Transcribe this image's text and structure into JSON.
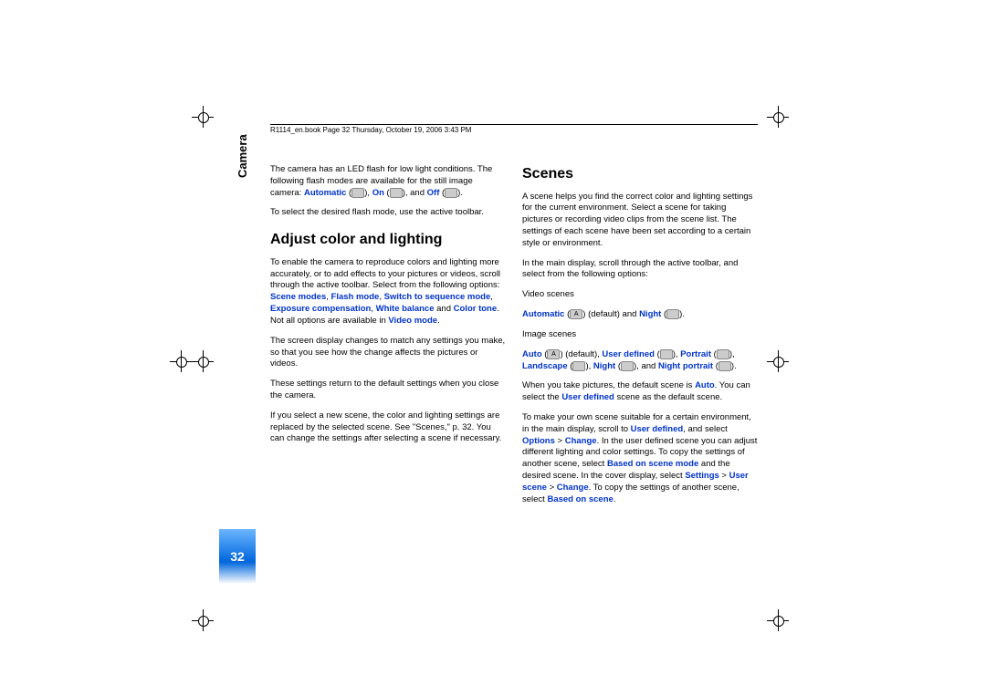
{
  "header": "R1114_en.book  Page 32  Thursday, October 19, 2006  3:43 PM",
  "side_label": "Camera",
  "page_number": "32",
  "col1": {
    "p1_a": "The camera has an LED flash for low light conditions. The following flash modes are available for the still image camera: ",
    "p1_auto": "Automatic",
    "p1_b": " (",
    "p1_c": "), ",
    "p1_on": "On",
    "p1_d": " (",
    "p1_e": "), and ",
    "p1_off": "Off",
    "p1_f": " (",
    "p1_g": ").",
    "p2": "To select the desired flash mode, use the active toolbar.",
    "h1": "Adjust color and lighting",
    "p3_a": "To enable the camera to reproduce colors and lighting more accurately, or to add effects to your pictures or videos, scroll through the active toolbar. Select from the following options: ",
    "p3_scene": "Scene modes",
    "p3_c1": ", ",
    "p3_flash": "Flash mode",
    "p3_c2": ", ",
    "p3_switch": "Switch to sequence mode",
    "p3_c3": ", ",
    "p3_exp": "Exposure compensation",
    "p3_c4": ", ",
    "p3_wb": "White balance",
    "p3_and": " and ",
    "p3_ct": "Color tone",
    "p3_b": ". Not all options are available in ",
    "p3_vm": "Video mode",
    "p3_d": ".",
    "p4": "The screen display changes to match any settings you make, so that you see how the change affects the pictures or videos.",
    "p5": "These settings return to the default settings when you close the camera.",
    "p6": "If you select a new scene, the color and lighting settings are replaced by the selected scene. See \"Scenes,\" p. 32. You can change the settings after selecting a scene if necessary."
  },
  "col2": {
    "h1": "Scenes",
    "p1": "A scene helps you find the correct color and lighting settings for the current environment. Select a scene for taking pictures or recording video clips from the scene list. The settings of each scene have been set according to a certain style or environment.",
    "p2": "In the main display, scroll through the active toolbar, and select from the following options:",
    "p3": "Video scenes",
    "p4_auto": "Automatic",
    "p4_a": " (",
    "p4_b": ") (default) and ",
    "p4_night": "Night",
    "p4_c": " (",
    "p4_d": ").",
    "p5": "Image scenes",
    "p6_auto": "Auto",
    "p6_a": " (",
    "p6_b": ") (default), ",
    "p6_ud": "User defined",
    "p6_c": " (",
    "p6_d": "), ",
    "p6_port": "Portrait",
    "p6_e": " (",
    "p6_f": "), ",
    "p6_land": "Landscape",
    "p6_g": " (",
    "p6_h": "), ",
    "p6_night": "Night",
    "p6_i": " (",
    "p6_j": "), and ",
    "p6_np": "Night portrait",
    "p6_k": " (",
    "p6_l": ").",
    "p7_a": "When you take pictures, the default scene is ",
    "p7_auto": "Auto",
    "p7_b": ". You can select the ",
    "p7_ud": "User defined",
    "p7_c": " scene as the default scene.",
    "p8_a": "To make your own scene suitable for a certain environment, in the main display, scroll to ",
    "p8_ud": "User defined",
    "p8_b": ", and select ",
    "p8_opt": "Options",
    "p8_gt1": " > ",
    "p8_chg": "Change",
    "p8_c": ". In the user defined scene you can adjust different lighting and color settings. To copy the settings of another scene, select ",
    "p8_bos": "Based on scene mode",
    "p8_d": " and the desired scene. In the cover display, select ",
    "p8_set": "Settings",
    "p8_gt2": " > ",
    "p8_us": "User scene",
    "p8_gt3": " > ",
    "p8_chg2": "Change",
    "p8_e": ". To copy the settings of another scene, select ",
    "p8_bos2": "Based on scene",
    "p8_f": "."
  },
  "iconA": "A"
}
